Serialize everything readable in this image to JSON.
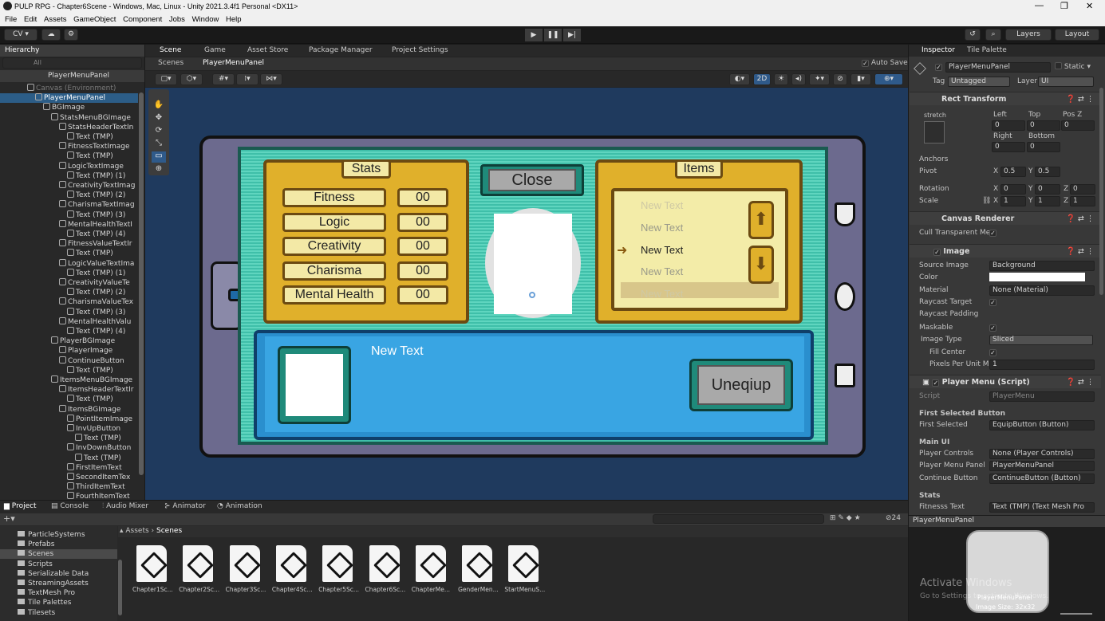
{
  "window": {
    "title": "PULP RPG - Chapter6Scene - Windows, Mac, Linux - Unity 2021.3.4f1 Personal <DX11>",
    "minimize": "—",
    "maximize": "❐",
    "close": "✕"
  },
  "menu": [
    "File",
    "Edit",
    "Assets",
    "GameObject",
    "Component",
    "Jobs",
    "Window",
    "Help"
  ],
  "toolbar": {
    "account": "CV ▾",
    "layers": "Layers",
    "layout": "Layout"
  },
  "hierarchy": {
    "tab": "Hierarchy",
    "search_placeholder": "All",
    "prefab_header": "PlayerMenuPanel",
    "rows": [
      {
        "label": "Canvas (Environment)",
        "indent": 0
      },
      {
        "label": "PlayerMenuPanel",
        "indent": 1,
        "selected": true
      },
      {
        "label": "BGImage",
        "indent": 2
      },
      {
        "label": "StatsMenuBGImage",
        "indent": 3
      },
      {
        "label": "StatsHeaderTextIn",
        "indent": 4
      },
      {
        "label": "Text (TMP)",
        "indent": 5
      },
      {
        "label": "FitnessTextImage",
        "indent": 4
      },
      {
        "label": "Text (TMP)",
        "indent": 5
      },
      {
        "label": "LogicTextImage",
        "indent": 4
      },
      {
        "label": "Text (TMP) (1)",
        "indent": 5
      },
      {
        "label": "CreativityTextImag",
        "indent": 4
      },
      {
        "label": "Text (TMP) (2)",
        "indent": 5
      },
      {
        "label": "CharismaTextImag",
        "indent": 4
      },
      {
        "label": "Text (TMP) (3)",
        "indent": 5
      },
      {
        "label": "MentalHealthTextI",
        "indent": 4
      },
      {
        "label": "Text (TMP) (4)",
        "indent": 5
      },
      {
        "label": "FitnessValueTextIr",
        "indent": 4
      },
      {
        "label": "Text (TMP)",
        "indent": 5
      },
      {
        "label": "LogicValueTextIma",
        "indent": 4
      },
      {
        "label": "Text (TMP) (1)",
        "indent": 5
      },
      {
        "label": "CreativityValueTe",
        "indent": 4
      },
      {
        "label": "Text (TMP) (2)",
        "indent": 5
      },
      {
        "label": "CharismaValueTex",
        "indent": 4
      },
      {
        "label": "Text (TMP) (3)",
        "indent": 5
      },
      {
        "label": "MentalHealthValu",
        "indent": 4
      },
      {
        "label": "Text (TMP) (4)",
        "indent": 5
      },
      {
        "label": "PlayerBGImage",
        "indent": 3
      },
      {
        "label": "PlayerImage",
        "indent": 4
      },
      {
        "label": "ContinueButton",
        "indent": 4
      },
      {
        "label": "Text (TMP)",
        "indent": 5
      },
      {
        "label": "ItemsMenuBGImage",
        "indent": 3
      },
      {
        "label": "ItemsHeaderTextIr",
        "indent": 4
      },
      {
        "label": "Text (TMP)",
        "indent": 5
      },
      {
        "label": "ItemsBGImage",
        "indent": 4
      },
      {
        "label": "PointItemImage",
        "indent": 5
      },
      {
        "label": "InvUpButton",
        "indent": 5
      },
      {
        "label": "Text (TMP)",
        "indent": 6
      },
      {
        "label": "InvDownButton",
        "indent": 5
      },
      {
        "label": "Text (TMP)",
        "indent": 6
      },
      {
        "label": "FirstItemText",
        "indent": 5
      },
      {
        "label": "SecondItemTex",
        "indent": 5
      },
      {
        "label": "ThirdItemText",
        "indent": 5
      },
      {
        "label": "FourthItemText",
        "indent": 5
      }
    ]
  },
  "center_tabs": [
    "Scene",
    "Game",
    "Asset Store",
    "Package Manager",
    "Project Settings"
  ],
  "scene": {
    "breadcrumb_root": "Scenes",
    "breadcrumb_item": "PlayerMenuPanel",
    "auto_save": "Auto Save",
    "mode_2d": "2D"
  },
  "game_ui": {
    "stats_header": "Stats",
    "items_header": "Items",
    "close_button": "Close",
    "unequip_button": "Uneqiup",
    "description": "New Text",
    "stats": [
      {
        "name": "Fitness",
        "value": "00"
      },
      {
        "name": "Logic",
        "value": "00"
      },
      {
        "name": "Creativity",
        "value": "00"
      },
      {
        "name": "Charisma",
        "value": "00"
      },
      {
        "name": "Mental Health",
        "value": "00"
      }
    ],
    "items": [
      "New Text",
      "New Text",
      "New Text",
      "New Text",
      "New Text"
    ]
  },
  "inspector": {
    "tabs": [
      "Inspector",
      "Tile Palette"
    ],
    "object_name": "PlayerMenuPanel",
    "static": "Static",
    "tag_label": "Tag",
    "tag_value": "Untagged",
    "layer_label": "Layer",
    "layer_value": "UI",
    "rect_transform": {
      "title": "Rect Transform",
      "stretch": "stretch",
      "left_label": "Left",
      "left": "0",
      "top_label": "Top",
      "top": "0",
      "posz_label": "Pos Z",
      "posz": "0",
      "right_label": "Right",
      "right": "0",
      "bottom_label": "Bottom",
      "bottom": "0",
      "anchors": "Anchors",
      "pivot_label": "Pivot",
      "pivot_x": "0.5",
      "pivot_y": "0.5",
      "rotation_label": "Rotation",
      "rot_x": "0",
      "rot_y": "0",
      "rot_z": "0",
      "scale_label": "Scale",
      "scale_x": "1",
      "scale_y": "1",
      "scale_z": "1"
    },
    "canvas_renderer": {
      "title": "Canvas Renderer",
      "cull_label": "Cull Transparent Mes"
    },
    "image": {
      "title": "Image",
      "source_label": "Source Image",
      "source_value": "Background",
      "color_label": "Color",
      "material_label": "Material",
      "material_value": "None (Material)",
      "raycast_target": "Raycast Target",
      "raycast_padding": "Raycast Padding",
      "maskable": "Maskable",
      "image_type_label": "Image Type",
      "image_type_value": "Sliced",
      "fill_center": "Fill Center",
      "ppu_label": "Pixels Per Unit Mul",
      "ppu_value": "1"
    },
    "player_menu": {
      "title": "Player Menu (Script)",
      "script_label": "Script",
      "script_value": "PlayerMenu",
      "first_selected_header": "First Selected Button",
      "first_selected_label": "First Selected",
      "first_selected_value": "EquipButton (Button)",
      "main_ui_header": "Main UI",
      "player_controls_label": "Player Controls",
      "player_controls_value": "None (Player Controls)",
      "player_menu_panel_label": "Player Menu Panel",
      "player_menu_panel_value": "PlayerMenuPanel",
      "continue_button_label": "Continue Button",
      "continue_button_value": "ContinueButton (Button)",
      "stats_header": "Stats",
      "fitness_text_label": "Fitnesss Text",
      "fitness_text_value": "Text (TMP) (Text Mesh Pro"
    },
    "preview": {
      "title": "PlayerMenuPanel",
      "label": "PlayerMenuPanel",
      "size": "Image Size: 32x32",
      "watermark1": "Activate Windows",
      "watermark2": "Go to Settings to activate Windows."
    }
  },
  "bottom_tabs": [
    "Project",
    "Console",
    "Audio Mixer",
    "Animator",
    "Animation"
  ],
  "project": {
    "tree": [
      "ParticleSystems",
      "Prefabs",
      "Scenes",
      "Scripts",
      "Serializable Data",
      "StreamingAssets",
      "TextMesh Pro",
      "Tile Palettes",
      "Tilesets"
    ],
    "breadcrumb_root": "Assets",
    "breadcrumb_item": "Scenes",
    "badge": "24",
    "assets": [
      "Chapter1Sc...",
      "Chapter2Sc...",
      "Chapter3Sc...",
      "Chapter4Sc...",
      "Chapter5Sc...",
      "Chapter6Sc...",
      "ChapterMe...",
      "GenderMen...",
      "StartMenuS..."
    ]
  }
}
